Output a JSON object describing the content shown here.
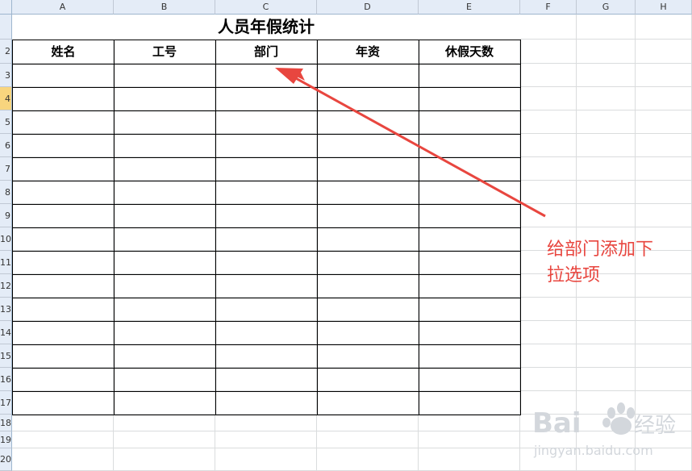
{
  "columns": [
    "A",
    "B",
    "C",
    "D",
    "E",
    "F",
    "G",
    "H"
  ],
  "rows": [
    "",
    "2",
    "3",
    "4",
    "5",
    "6",
    "7",
    "8",
    "9",
    "10",
    "11",
    "12",
    "13",
    "14",
    "15",
    "16",
    "17",
    "18",
    "19",
    "20"
  ],
  "selected_row": "4",
  "sheet": {
    "title": "人员年假统计",
    "headers": [
      "姓名",
      "工号",
      "部门",
      "年资",
      "休假天数"
    ]
  },
  "annotation": {
    "line1": "给部门添加下",
    "line2": "拉选项",
    "color": "#e8463f"
  },
  "watermark": {
    "logo": "Bai du 经验",
    "url": "jingyan.baidu.com"
  }
}
